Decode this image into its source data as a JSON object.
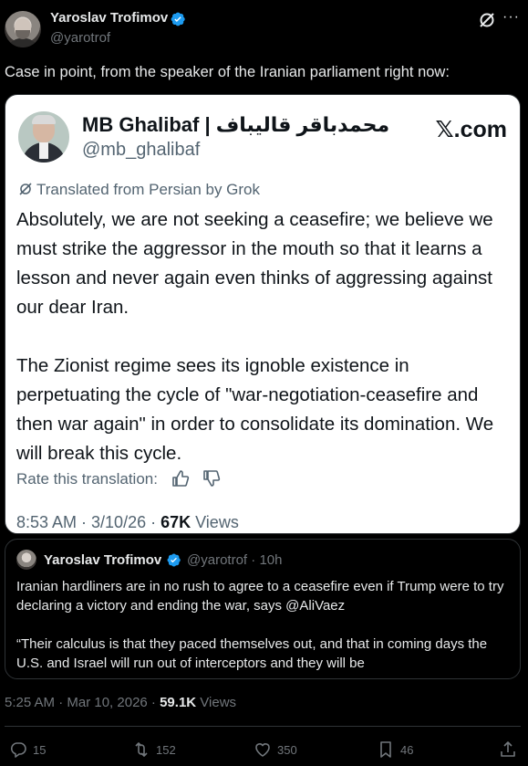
{
  "author": {
    "name": "Yaroslav Trofimov",
    "handle": "@yarotrof",
    "verified": true
  },
  "tweet": {
    "text": "Case in point, from the speaker of the Iranian parliament right now:"
  },
  "embedded_image": {
    "author_name": "MB Ghalibaf | محمدباقر قالیباف",
    "author_handle": "@mb_ghalibaf",
    "logo": "𝕏.com",
    "translated_label": "Translated from Persian by Grok",
    "paragraph_1": "Absolutely, we are not seeking a ceasefire; we believe we must strike the aggressor in the mouth so that it learns a lesson and never again even thinks of aggressing against our dear Iran.",
    "paragraph_2": "The Zionist regime sees its ignoble existence in perpetuating the cycle of \"war-negotiation-ceasefire and then war again\" in order to consolidate its domination. We will break this cycle.",
    "rate_label": "Rate this translation:",
    "time_date": "8:53 AM · 3/10/26 · ",
    "views_count": "67K",
    "views_label": " Views"
  },
  "quote": {
    "name": "Yaroslav Trofimov",
    "handle": "@yarotrof",
    "time": "10h",
    "paragraph_1": "Iranian hardliners are in no rush to agree to a ceasefire even if Trump were to try declaring a victory and ending the war, says @AliVaez",
    "paragraph_2": "“Their calculus is that they paced themselves out, and that in coming days the U.S. and Israel will run out of interceptors and they will be"
  },
  "meta": {
    "time_date": "5:25 AM · Mar 10, 2026 · ",
    "views_count": "59.1K",
    "views_label": " Views"
  },
  "actions": {
    "replies": "15",
    "reposts": "152",
    "likes": "350",
    "bookmarks": "46"
  },
  "colors": {
    "background": "#000000",
    "text": "#e7e9ea",
    "muted": "#71767b",
    "verified": "#1d9bf0",
    "border": "#2f3336"
  }
}
